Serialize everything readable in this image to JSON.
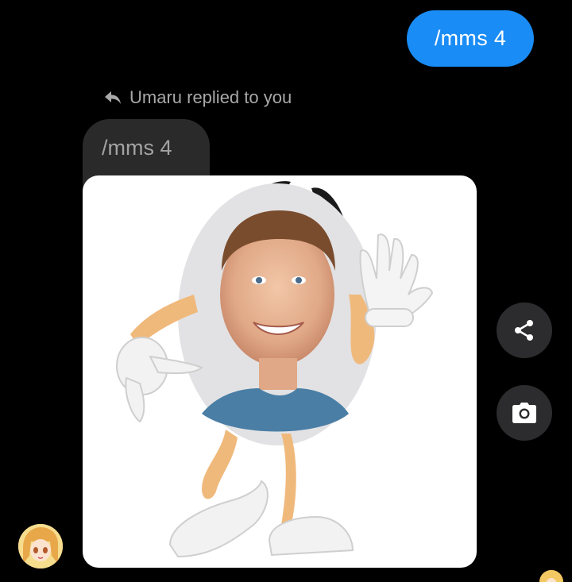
{
  "sent_message": {
    "text": "/mms 4"
  },
  "reply": {
    "label": "Umaru replied to you",
    "quoted_text": "/mms 4"
  },
  "image_message": {
    "icon": "photo-mascot-image"
  },
  "actions": {
    "share_icon": "share-icon",
    "camera_icon": "camera-icon"
  },
  "colors": {
    "sent_bubble": "#1a8cf5",
    "quoted_bubble": "#2a2a2a",
    "background": "#000000",
    "action_button": "#2c2c2e"
  }
}
